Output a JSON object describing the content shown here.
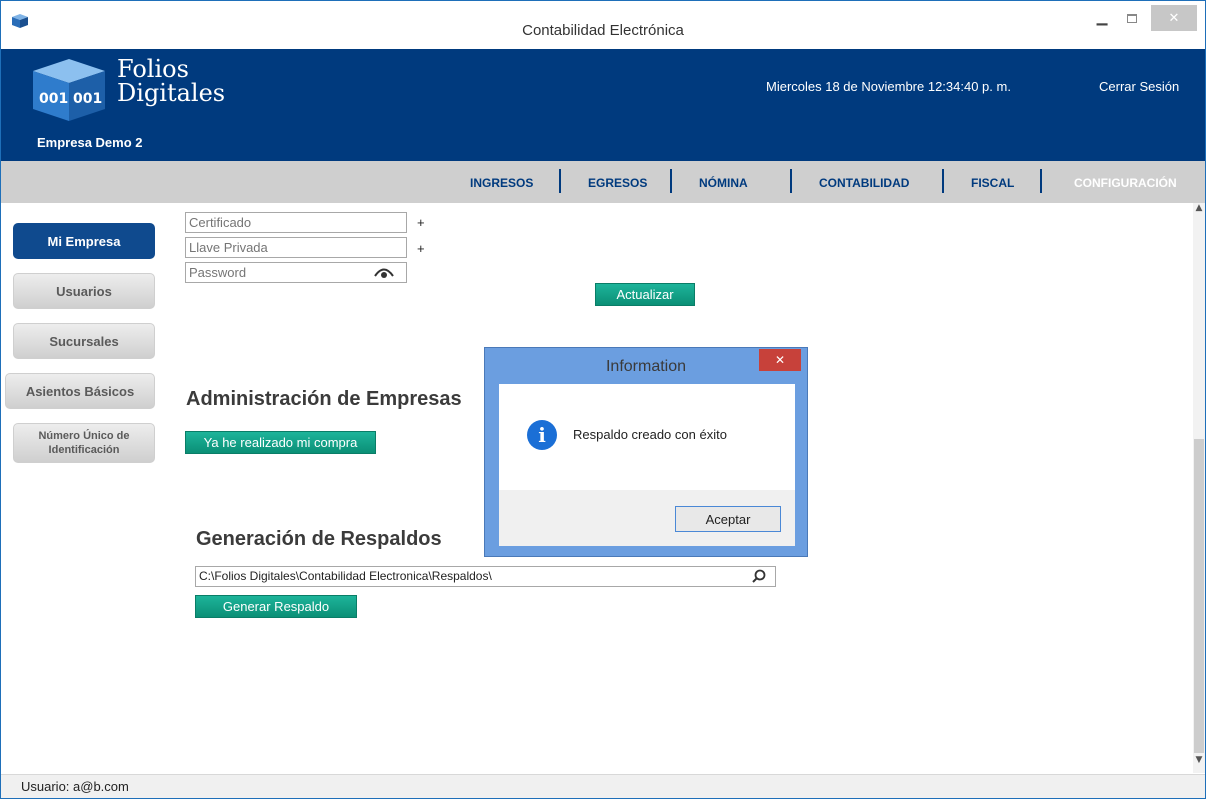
{
  "window": {
    "title": "Contabilidad Electrónica"
  },
  "header": {
    "logo_line1": "Folios",
    "logo_line2": "Digitales",
    "company": "Empresa Demo 2",
    "datetime": "Miercoles 18 de Noviembre 12:34:40 p. m.",
    "logout": "Cerrar Sesión"
  },
  "nav": {
    "items": [
      "INGRESOS",
      "EGRESOS",
      "NÓMINA",
      "CONTABILIDAD",
      "FISCAL",
      "CONFIGURACIÓN"
    ],
    "active": "CONFIGURACIÓN"
  },
  "sidebar": {
    "items": [
      "Mi Empresa",
      "Usuarios",
      "Sucursales",
      "Asientos Básicos",
      "Número Único de Identificación"
    ],
    "active": "Mi Empresa"
  },
  "form": {
    "certificado_placeholder": "Certificado",
    "llave_placeholder": "Llave Privada",
    "password_placeholder": "Password",
    "plus": "+",
    "update_button": "Actualizar"
  },
  "admin": {
    "title": "Administración de Empresas",
    "button": "Ya he realizado mi compra"
  },
  "backup": {
    "title": "Generación de Respaldos",
    "path": "C:\\Folios Digitales\\Contabilidad Electronica\\Respaldos\\",
    "button": "Generar Respaldo"
  },
  "status": {
    "user": "Usuario: a@b.com"
  },
  "dialog": {
    "title": "Information",
    "message": "Respaldo creado con éxito",
    "ok": "Aceptar",
    "info_glyph": "i"
  },
  "colors": {
    "header_bg": "#003a7e",
    "nav_bg": "#cfcfcf",
    "active_sidebar": "#0f4a8e",
    "green_button": "#0b8f76",
    "dialog_frame": "#6b9ee0",
    "dialog_close": "#c7413a"
  }
}
